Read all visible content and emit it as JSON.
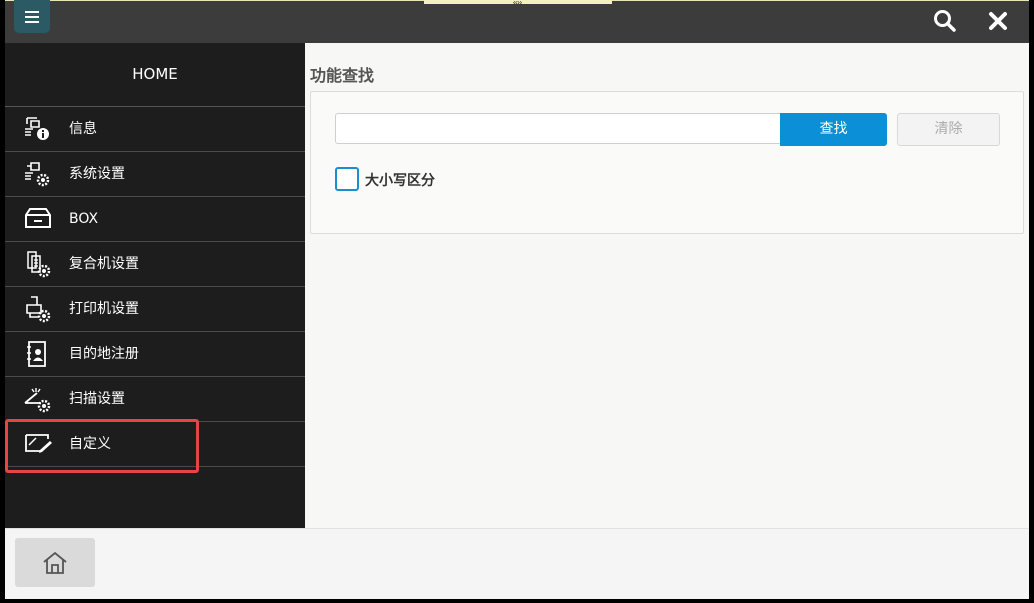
{
  "sidebar": {
    "home_label": "HOME",
    "items": [
      {
        "label": "信息",
        "icon": "info-device-icon"
      },
      {
        "label": "系统设置",
        "icon": "system-settings-icon"
      },
      {
        "label": "BOX",
        "icon": "box-tray-icon"
      },
      {
        "label": "复合机设置",
        "icon": "copier-settings-icon"
      },
      {
        "label": "打印机设置",
        "icon": "printer-settings-icon"
      },
      {
        "label": "目的地注册",
        "icon": "address-book-icon"
      },
      {
        "label": "扫描设置",
        "icon": "scan-settings-icon"
      },
      {
        "label": "自定义",
        "icon": "customize-icon"
      }
    ]
  },
  "main": {
    "title": "功能查找",
    "search": {
      "value": "",
      "placeholder": ""
    },
    "find_label": "查找",
    "clear_label": "清除",
    "case_label": "大小写区分",
    "case_checked": false
  },
  "colors": {
    "accent": "#0b8fd6",
    "highlight": "#e64545",
    "menu_button": "#2b5a64"
  }
}
